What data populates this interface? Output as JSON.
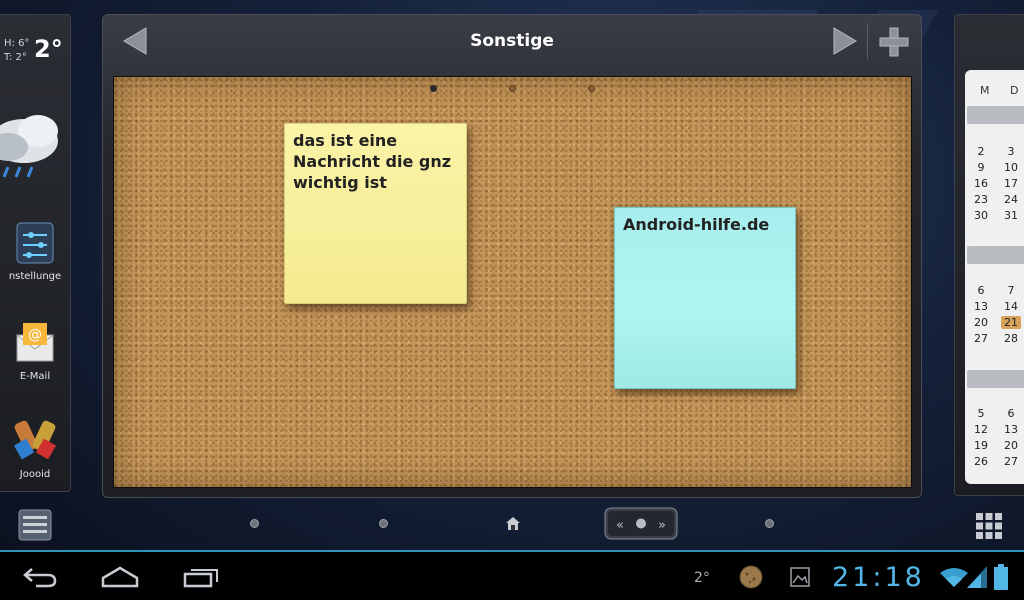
{
  "left_panel": {
    "weather": {
      "high": "H: 6°",
      "low": "T: 2°",
      "current": "2°"
    },
    "apps": [
      {
        "label": "nstellunge",
        "icon": "settings-icon"
      },
      {
        "label": "E-Mail",
        "icon": "email-icon"
      },
      {
        "label": "Joooid",
        "icon": "joooid-icon"
      }
    ]
  },
  "board": {
    "title": "Sonstige",
    "page_indicator": {
      "count": 3,
      "active": 0
    },
    "notes": [
      {
        "text": "das ist eine Nachricht die gnz wichtig ist",
        "color": "#f8f09f"
      },
      {
        "text": "Android-hilfe.de",
        "color": "#a9f2ef"
      }
    ]
  },
  "calendar": {
    "weekdays": [
      "M",
      "D"
    ],
    "weeks_a": [
      [
        "2",
        "3"
      ],
      [
        "9",
        "10"
      ],
      [
        "16",
        "17"
      ],
      [
        "23",
        "24"
      ],
      [
        "30",
        "31"
      ]
    ],
    "weeks_b": [
      [
        "6",
        "7"
      ],
      [
        "13",
        "14"
      ],
      [
        "20",
        "21"
      ],
      [
        "27",
        "28"
      ]
    ],
    "weeks_c": [
      [
        "5",
        "6"
      ],
      [
        "12",
        "13"
      ],
      [
        "19",
        "20"
      ],
      [
        "26",
        "27"
      ]
    ],
    "today": "21"
  },
  "status_bar": {
    "temperature": "2°",
    "clock": "21:18"
  },
  "colors": {
    "accent": "#33b5e5",
    "cork": "#c39558",
    "note_yellow": "#f8f09f",
    "note_cyan": "#a9f2ef"
  }
}
